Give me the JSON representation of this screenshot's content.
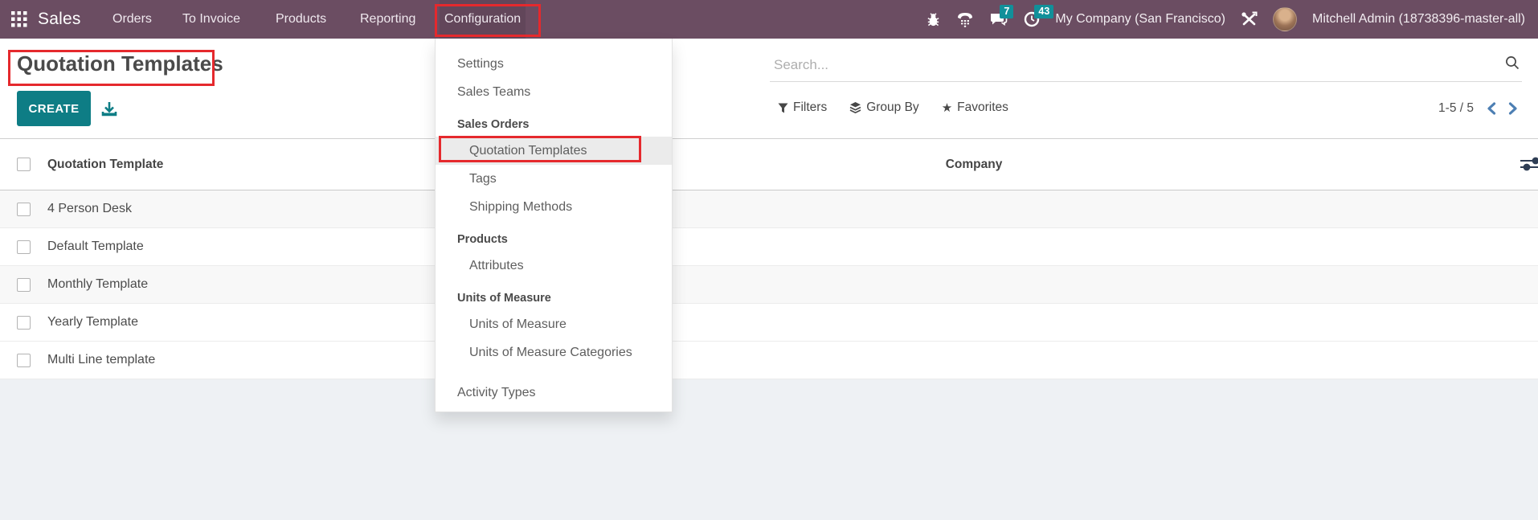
{
  "colors": {
    "nav-bg": "#6b4d62",
    "primary": "#0e7d85",
    "badge": "#11909a",
    "annotation": "#e5292d",
    "pager-arrow": "#4d7fb3"
  },
  "nav": {
    "app_name": "Sales",
    "items": [
      {
        "label": "Orders"
      },
      {
        "label": "To Invoice"
      },
      {
        "label": "Products"
      },
      {
        "label": "Reporting"
      },
      {
        "label": "Configuration"
      }
    ],
    "message_badge": "7",
    "activity_badge": "43",
    "company": "My Company (San Francisco)",
    "user": "Mitchell Admin (18738396-master-all)"
  },
  "page": {
    "title": "Quotation Templates",
    "create_label": "CREATE"
  },
  "search": {
    "placeholder": "Search..."
  },
  "filter_bar": {
    "filters": "Filters",
    "group_by": "Group By",
    "favorites": "Favorites"
  },
  "pager": {
    "range": "1-5 / 5"
  },
  "icons": {
    "favorites_star": "★"
  },
  "table": {
    "col_template": "Quotation Template",
    "col_company": "Company",
    "rows": [
      {
        "name": "4 Person Desk"
      },
      {
        "name": "Default Template"
      },
      {
        "name": "Monthly Template"
      },
      {
        "name": "Yearly Template"
      },
      {
        "name": "Multi Line template"
      }
    ]
  },
  "menu": {
    "items": [
      {
        "label": "Settings"
      },
      {
        "label": "Sales Teams"
      },
      {
        "label": "Sales Orders"
      },
      {
        "label": "Quotation Templates"
      },
      {
        "label": "Tags"
      },
      {
        "label": "Shipping Methods"
      },
      {
        "label": "Products"
      },
      {
        "label": "Attributes"
      },
      {
        "label": "Units of Measure"
      },
      {
        "label": "Units of Measure"
      },
      {
        "label": "Units of Measure Categories"
      },
      {
        "label": "Activity Types"
      }
    ]
  }
}
